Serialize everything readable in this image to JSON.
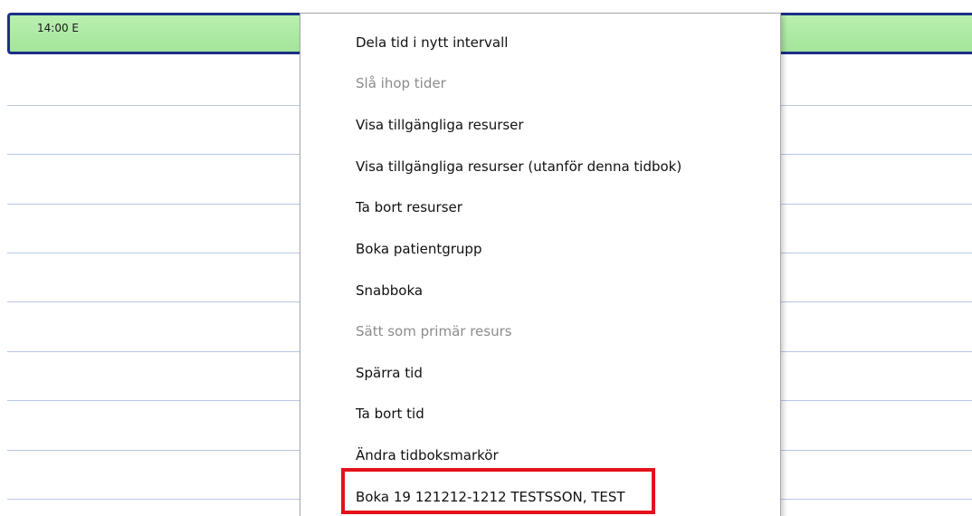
{
  "schedule": {
    "slot_label": "14:00 E",
    "slot_color": "#a9e8a0",
    "slot_border_color": "#1c2f86",
    "grid_color": "#b7c8e6"
  },
  "context_menu": {
    "items": [
      {
        "label": "Dela tid i nytt intervall",
        "enabled": true
      },
      {
        "label": "Slå ihop tider",
        "enabled": false
      },
      {
        "label": "Visa tillgängliga resurser",
        "enabled": true
      },
      {
        "label": "Visa tillgängliga resurser (utanför denna tidbok)",
        "enabled": true
      },
      {
        "label": "Ta bort resurser",
        "enabled": true
      },
      {
        "label": "Boka patientgrupp",
        "enabled": true
      },
      {
        "label": "Snabboka",
        "enabled": true
      },
      {
        "label": "Sätt som primär resurs",
        "enabled": false
      },
      {
        "label": "Spärra tid",
        "enabled": true
      },
      {
        "label": "Ta bort tid",
        "enabled": true
      },
      {
        "label": "Ändra tidboksmarkör",
        "enabled": true
      },
      {
        "label": "Boka 19 121212-1212 TESTSSON, TEST",
        "enabled": true,
        "highlighted": true
      }
    ],
    "highlight_color": "#e3121b"
  }
}
